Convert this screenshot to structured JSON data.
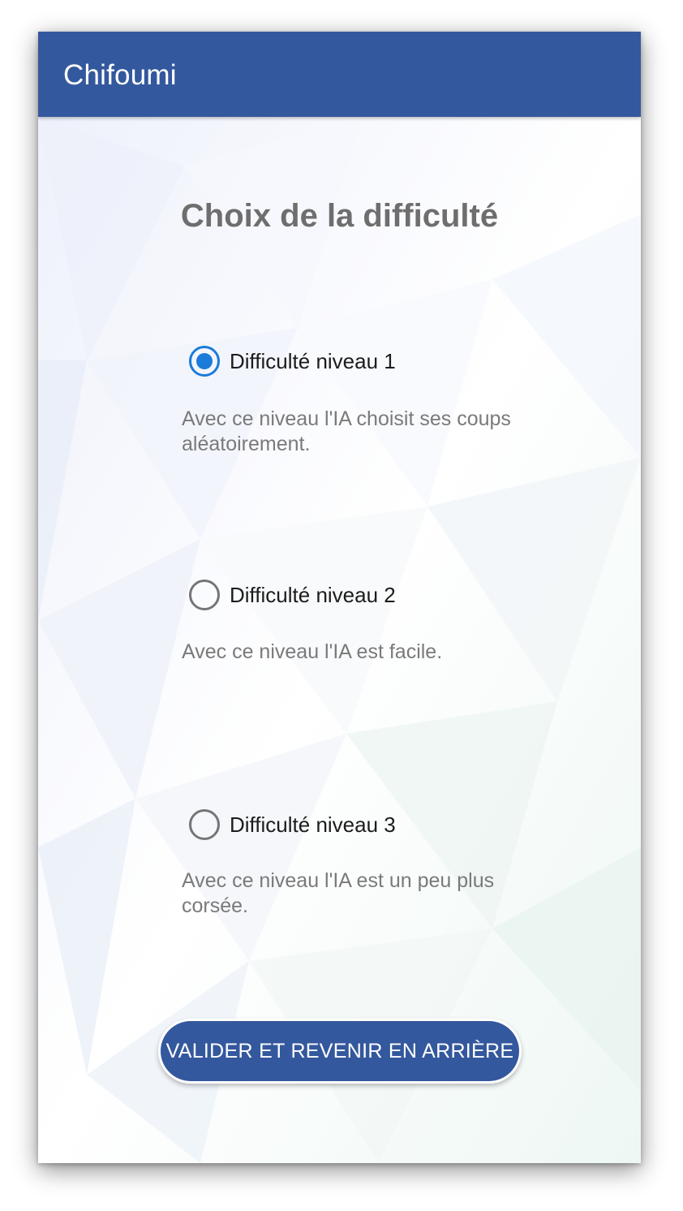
{
  "appbar": {
    "title": "Chifoumi"
  },
  "page": {
    "title": "Choix de la difficulté"
  },
  "options": [
    {
      "label": "Difficulté niveau 1",
      "description": "Avec ce niveau l'IA choisit ses coups aléatoirement.",
      "selected": true
    },
    {
      "label": "Difficulté niveau 2",
      "description": "Avec ce niveau l'IA est facile.",
      "selected": false
    },
    {
      "label": "Difficulté niveau 3",
      "description": "Avec ce niveau l'IA est un peu plus corsée.",
      "selected": false
    }
  ],
  "actions": {
    "validate_label": "VALIDER ET REVENIR EN ARRIÈRE"
  },
  "colors": {
    "primary": "#34589d",
    "radio_selected": "#1a7bd9",
    "radio_unselected": "#757575"
  },
  "icons": {
    "radio_checked": "radio-checked-icon",
    "radio_unchecked": "radio-unchecked-icon"
  }
}
